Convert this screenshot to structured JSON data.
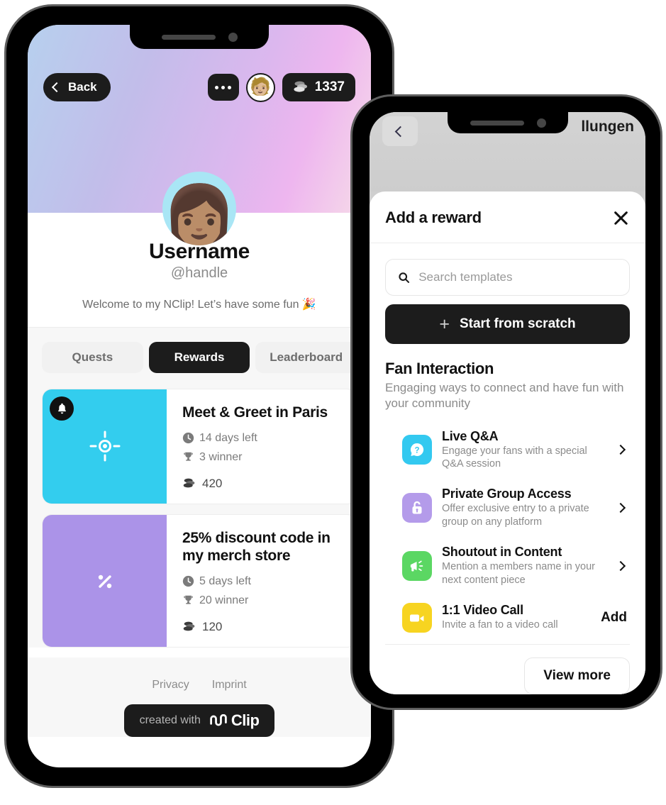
{
  "phone_a": {
    "topbar": {
      "back_label": "Back",
      "more_icon": "ellipsis-icon",
      "avatar_icon": "user-avatar-emoji",
      "coin_icon": "coins-icon",
      "coin_balance": "1337"
    },
    "profile": {
      "avatar_icon": "profile-avatar-emoji",
      "name": "Username",
      "handle": "@handle",
      "bio": "Welcome to my NClip! Let’s have some fun 🎉"
    },
    "tabs": [
      {
        "label": "Quests",
        "active": false
      },
      {
        "label": "Rewards",
        "active": true
      },
      {
        "label": "Leaderboard",
        "active": false
      }
    ],
    "rewards": [
      {
        "title": "Meet & Greet in Paris",
        "days_left": "14 days left",
        "winners": "3 winner",
        "price": "420",
        "thumb_color": "#33CDEE",
        "thumb_icon": "target-icon",
        "badge_icon": "bell-icon"
      },
      {
        "title": "25% discount code in my merch store",
        "days_left": "5 days left",
        "winners": "20 winner",
        "price": "120",
        "thumb_color": "#AB93E8",
        "thumb_icon": "percent-icon",
        "badge_icon": ""
      }
    ],
    "footer": {
      "links": [
        "Privacy",
        "Imprint"
      ],
      "badge_prefix": "created with",
      "badge_brand": "Clip",
      "badge_logo_icon": "nclip-logo-icon"
    }
  },
  "phone_b": {
    "page": {
      "back_icon": "chevron-left-icon",
      "title": "llungen"
    },
    "sheet": {
      "title": "Add a reward",
      "close_icon": "close-icon",
      "search_placeholder": "Search templates",
      "search_value": "",
      "search_icon": "search-icon",
      "scratch_label": "Start from scratch",
      "scratch_icon": "plus-icon",
      "section_title": "Fan Interaction",
      "section_subtitle": "Engaging ways to connect and have fun with your community",
      "templates": [
        {
          "name": "Live Q&A",
          "desc": "Engage your fans with a special Q&A session",
          "color": "#33C9F0",
          "icon": "question-bubble-icon",
          "action": "chevron",
          "action_label": ""
        },
        {
          "name": "Private Group Access",
          "desc": "Offer exclusive entry to a private group on any platform",
          "color": "#B49BEA",
          "icon": "lock-icon",
          "action": "chevron",
          "action_label": ""
        },
        {
          "name": "Shoutout in Content",
          "desc": "Mention a members name in your next content piece",
          "color": "#5BD763",
          "icon": "megaphone-icon",
          "action": "chevron",
          "action_label": ""
        },
        {
          "name": "1:1 Video Call",
          "desc": "Invite a fan to a video call",
          "color": "#F7D421",
          "icon": "video-camera-icon",
          "action": "add",
          "action_label": "Add"
        }
      ],
      "view_more_label": "View more"
    }
  }
}
